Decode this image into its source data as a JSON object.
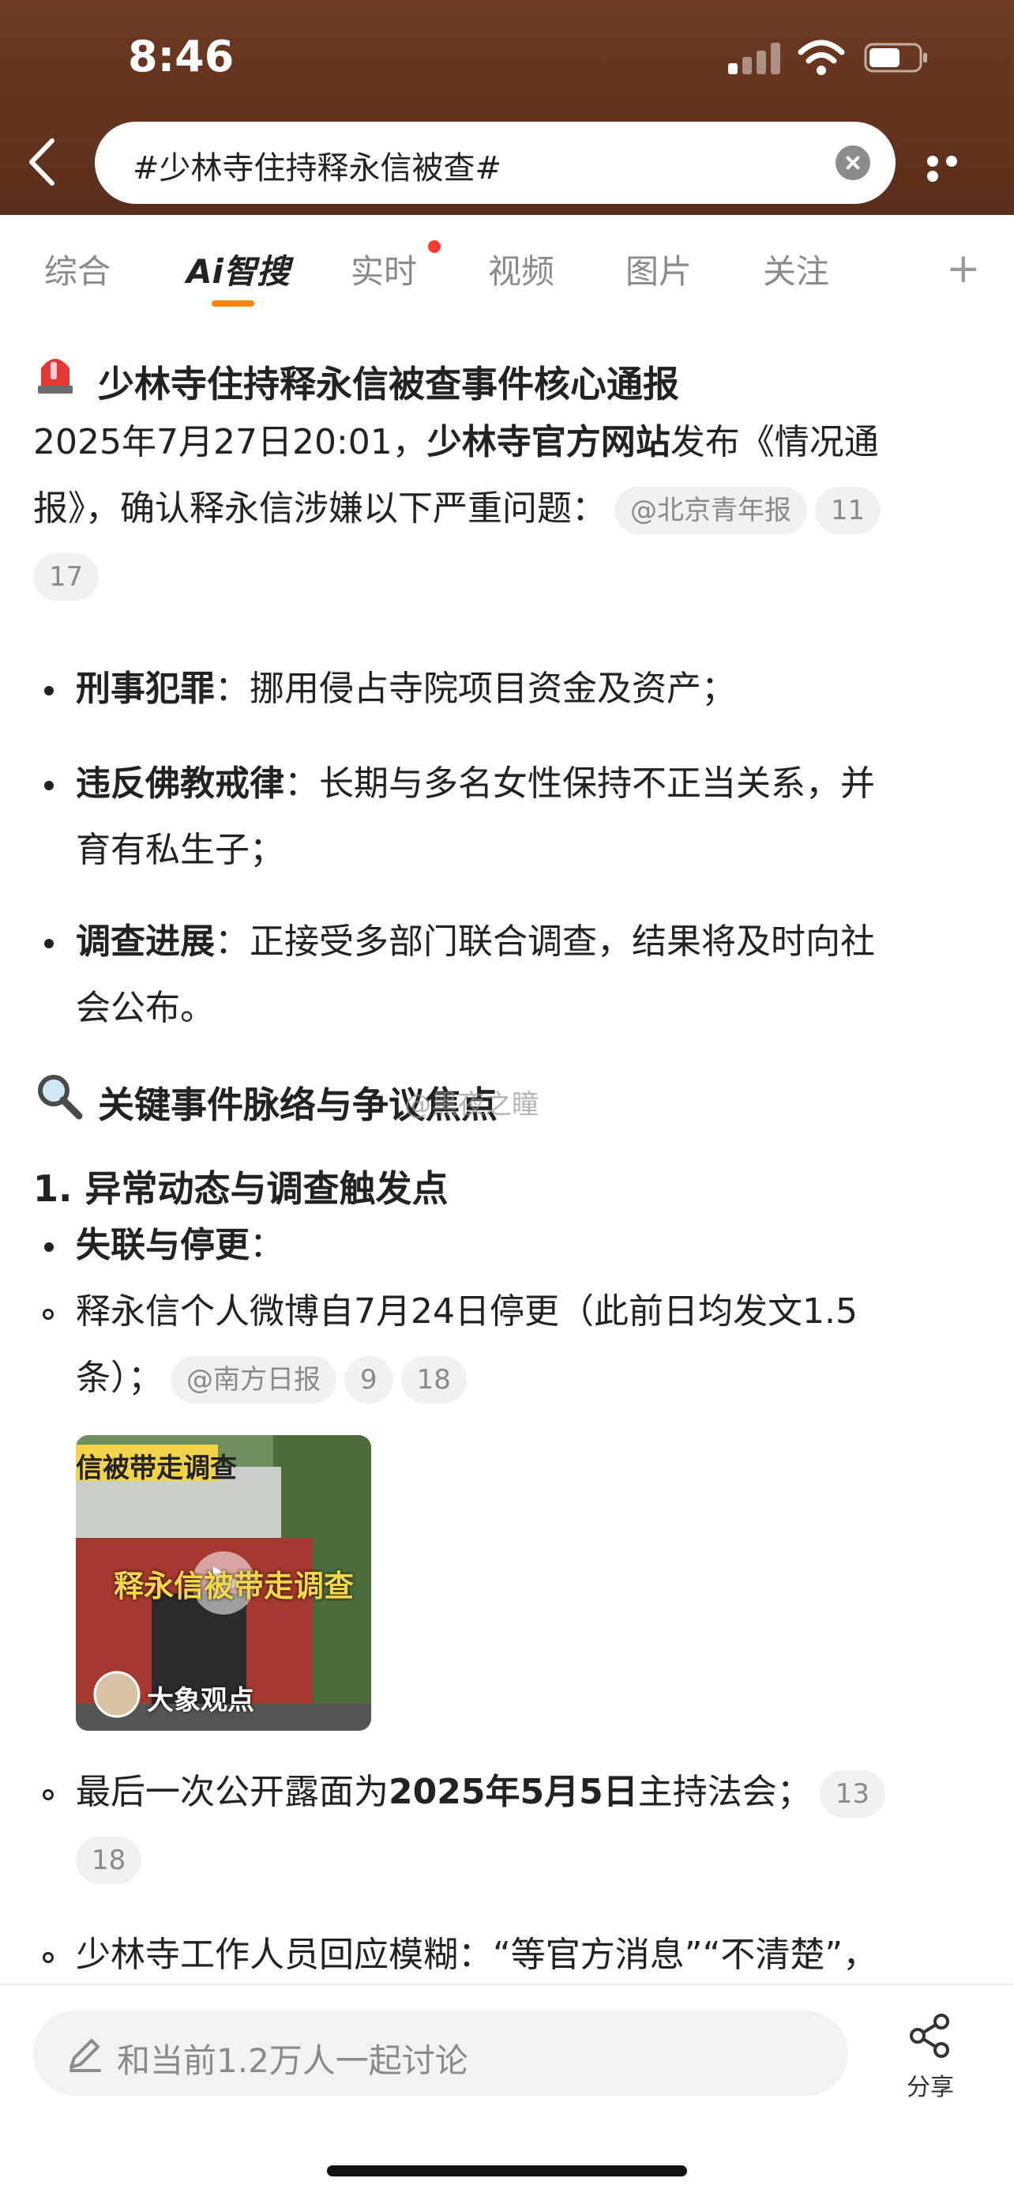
{
  "status_bar": {
    "time": "8:46"
  },
  "search": {
    "query": "#少林寺住持释永信被查#"
  },
  "tabs": [
    {
      "label": "综合"
    },
    {
      "label": "Ai智搜"
    },
    {
      "label": "实时"
    },
    {
      "label": "视频"
    },
    {
      "label": "图片"
    },
    {
      "label": "关注"
    }
  ],
  "article": {
    "section1_title": "少林寺住持释永信被查事件核心通报",
    "intro_part1": "2025年7月27日20:01，",
    "intro_bold": "少林寺官方网站",
    "intro_part2": "发布《情况通",
    "intro_line2": "报》，确认释永信涉嫌以下严重问题：",
    "intro_source": "@北京青年报",
    "intro_count1": "11",
    "intro_count2": "17",
    "bullets": [
      {
        "title": "刑事犯罪",
        "text": "：挪用侵占寺院项目资金及资产；"
      },
      {
        "title": "违反佛教戒律",
        "text": "：长期与多名女性保持不正当关系，并",
        "text2": "育有私生子；"
      },
      {
        "title": "调查进展",
        "text": "：正接受多部门联合调查，结果将及时向社",
        "text2": "会公布。"
      }
    ],
    "section2_title": "关键事件脉络与争议焦点",
    "watermark": "@黑夜之瞳",
    "sub_heading": "1. 异常动态与调查触发点",
    "sub_bullet": "失联与停更",
    "sub_bullet_colon": "：",
    "item1_line1": "释永信个人微博自7月24日停更（此前日均发文1.5",
    "item1_line2": "条）；",
    "item1_source": "@南方日报",
    "item1_count1": "9",
    "item1_count2": "18",
    "video_banner": "信被带走调查",
    "video_title": "释永信被带走调查",
    "video_author": "大象观点",
    "item2_part1": "最后一次公开露面为",
    "item2_bold": "2025年5月5日",
    "item2_part2": "主持法会；",
    "item2_count1": "13",
    "item2_count2": "18",
    "item3_line1": "少林寺工作人员回应模糊：“等官方消息”“不清楚”，"
  },
  "bottom_bar": {
    "discuss_placeholder": "和当前1.2万人一起讨论",
    "share_label": "分享"
  }
}
